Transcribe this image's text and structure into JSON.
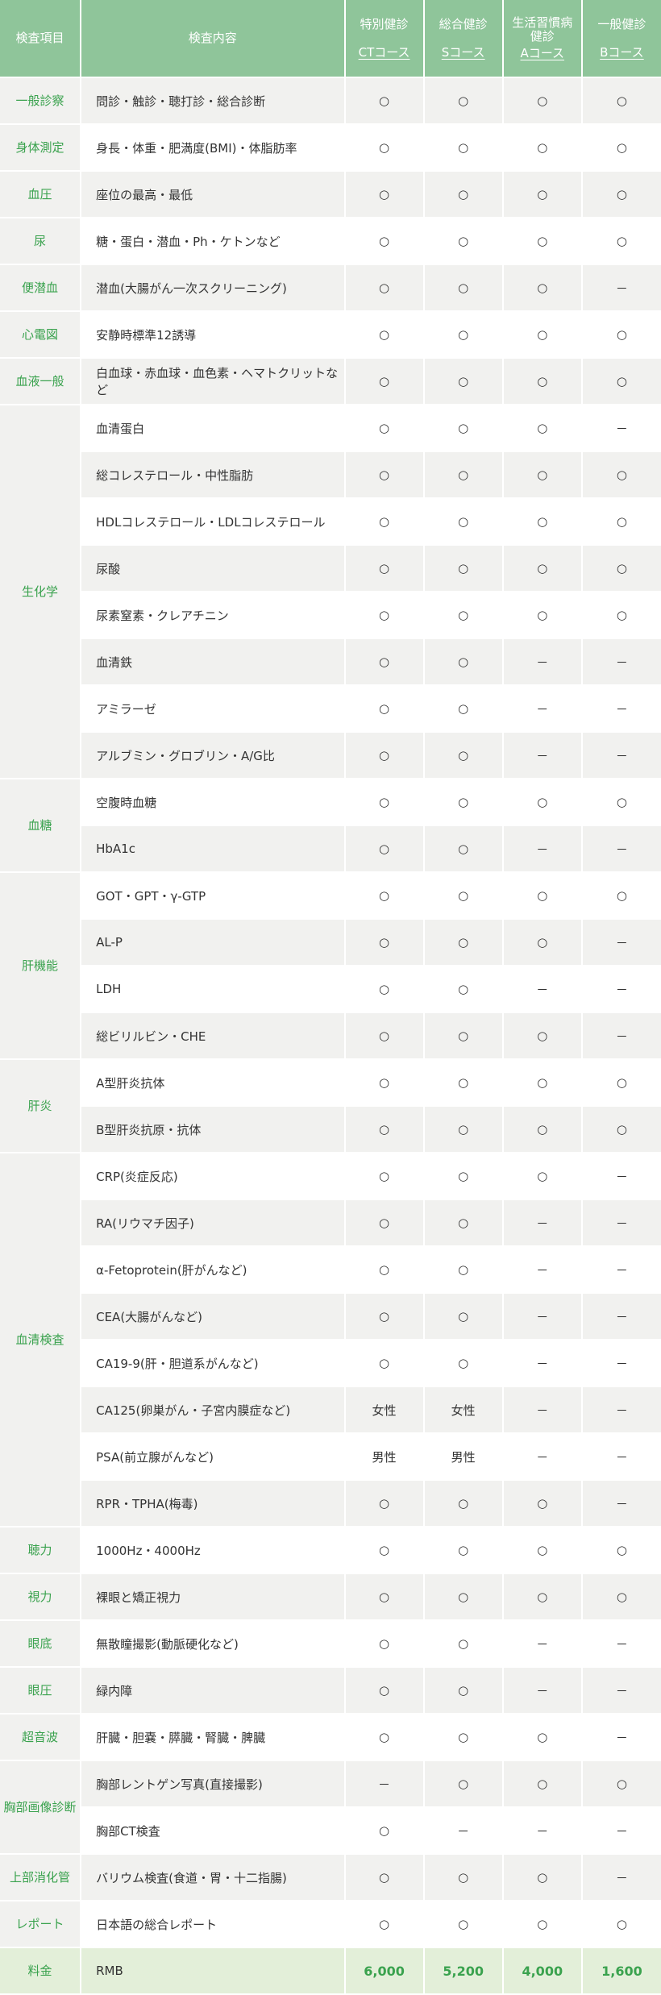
{
  "header": {
    "category": "検査項目",
    "content": "検査内容",
    "courses": [
      {
        "name": "特別健診",
        "code": "CTコース"
      },
      {
        "name": "総合健診",
        "code": "Sコース"
      },
      {
        "name": "生活習慣病健診",
        "code": "Aコース"
      },
      {
        "name": "一般健診",
        "code": "Bコース"
      }
    ]
  },
  "groups": [
    {
      "category": "一般診察",
      "rows": [
        {
          "item": "問診・触診・聴打診・総合診断",
          "marks": [
            "○",
            "○",
            "○",
            "○"
          ]
        }
      ]
    },
    {
      "category": "身体測定",
      "rows": [
        {
          "item": "身長・体重・肥満度(BMI)・体脂肪率",
          "marks": [
            "○",
            "○",
            "○",
            "○"
          ]
        }
      ]
    },
    {
      "category": "血圧",
      "rows": [
        {
          "item": "座位の最高・最低",
          "marks": [
            "○",
            "○",
            "○",
            "○"
          ]
        }
      ]
    },
    {
      "category": "尿",
      "rows": [
        {
          "item": "糖・蛋白・潜血・Ph・ケトンなど",
          "marks": [
            "○",
            "○",
            "○",
            "○"
          ]
        }
      ]
    },
    {
      "category": "便潜血",
      "rows": [
        {
          "item": "潜血(大腸がん一次スクリーニング)",
          "marks": [
            "○",
            "○",
            "○",
            "－"
          ]
        }
      ]
    },
    {
      "category": "心電図",
      "rows": [
        {
          "item": "安静時標準12誘導",
          "marks": [
            "○",
            "○",
            "○",
            "○"
          ]
        }
      ]
    },
    {
      "category": "血液一般",
      "rows": [
        {
          "item": "白血球・赤血球・血色素・ヘマトクリットなど",
          "marks": [
            "○",
            "○",
            "○",
            "○"
          ]
        }
      ]
    },
    {
      "category": "生化学",
      "rows": [
        {
          "item": "血清蛋白",
          "marks": [
            "○",
            "○",
            "○",
            "－"
          ]
        },
        {
          "item": "総コレステロール・中性脂肪",
          "marks": [
            "○",
            "○",
            "○",
            "○"
          ]
        },
        {
          "item": "HDLコレステロール・LDLコレステロール",
          "marks": [
            "○",
            "○",
            "○",
            "○"
          ]
        },
        {
          "item": "尿酸",
          "marks": [
            "○",
            "○",
            "○",
            "○"
          ]
        },
        {
          "item": "尿素窒素・クレアチニン",
          "marks": [
            "○",
            "○",
            "○",
            "○"
          ]
        },
        {
          "item": "血清鉄",
          "marks": [
            "○",
            "○",
            "－",
            "－"
          ]
        },
        {
          "item": "アミラーゼ",
          "marks": [
            "○",
            "○",
            "－",
            "－"
          ]
        },
        {
          "item": "アルブミン・グロブリン・A/G比",
          "marks": [
            "○",
            "○",
            "－",
            "－"
          ]
        }
      ]
    },
    {
      "category": "血糖",
      "rows": [
        {
          "item": "空腹時血糖",
          "marks": [
            "○",
            "○",
            "○",
            "○"
          ]
        },
        {
          "item": "HbA1c",
          "marks": [
            "○",
            "○",
            "－",
            "－"
          ]
        }
      ]
    },
    {
      "category": "肝機能",
      "rows": [
        {
          "item": "GOT・GPT・γ-GTP",
          "marks": [
            "○",
            "○",
            "○",
            "○"
          ]
        },
        {
          "item": "AL-P",
          "marks": [
            "○",
            "○",
            "○",
            "－"
          ]
        },
        {
          "item": "LDH",
          "marks": [
            "○",
            "○",
            "－",
            "－"
          ]
        },
        {
          "item": "総ビリルビン・CHE",
          "marks": [
            "○",
            "○",
            "○",
            "－"
          ]
        }
      ]
    },
    {
      "category": "肝炎",
      "rows": [
        {
          "item": "A型肝炎抗体",
          "marks": [
            "○",
            "○",
            "○",
            "○"
          ]
        },
        {
          "item": "B型肝炎抗原・抗体",
          "marks": [
            "○",
            "○",
            "○",
            "○"
          ]
        }
      ]
    },
    {
      "category": "血清検査",
      "rows": [
        {
          "item": "CRP(炎症反応)",
          "marks": [
            "○",
            "○",
            "○",
            "－"
          ]
        },
        {
          "item": "RA(リウマチ因子)",
          "marks": [
            "○",
            "○",
            "－",
            "－"
          ]
        },
        {
          "item": "α-Fetoprotein(肝がんなど)",
          "marks": [
            "○",
            "○",
            "－",
            "－"
          ]
        },
        {
          "item": "CEA(大腸がんなど)",
          "marks": [
            "○",
            "○",
            "－",
            "－"
          ]
        },
        {
          "item": "CA19-9(肝・胆道系がんなど)",
          "marks": [
            "○",
            "○",
            "－",
            "－"
          ]
        },
        {
          "item": "CA125(卵巣がん・子宮内膜症など)",
          "marks": [
            "女性",
            "女性",
            "－",
            "－"
          ]
        },
        {
          "item": "PSA(前立腺がんなど)",
          "marks": [
            "男性",
            "男性",
            "－",
            "－"
          ]
        },
        {
          "item": "RPR・TPHA(梅毒)",
          "marks": [
            "○",
            "○",
            "○",
            "－"
          ]
        }
      ]
    },
    {
      "category": "聴力",
      "rows": [
        {
          "item": "1000Hz・4000Hz",
          "marks": [
            "○",
            "○",
            "○",
            "○"
          ]
        }
      ]
    },
    {
      "category": "視力",
      "rows": [
        {
          "item": "裸眼と矯正視力",
          "marks": [
            "○",
            "○",
            "○",
            "○"
          ]
        }
      ]
    },
    {
      "category": "眼底",
      "rows": [
        {
          "item": "無散瞳撮影(動脈硬化など)",
          "marks": [
            "○",
            "○",
            "－",
            "－"
          ]
        }
      ]
    },
    {
      "category": "眼圧",
      "rows": [
        {
          "item": "緑内障",
          "marks": [
            "○",
            "○",
            "－",
            "－"
          ]
        }
      ]
    },
    {
      "category": "超音波",
      "rows": [
        {
          "item": "肝臓・胆嚢・膵臓・腎臓・脾臓",
          "marks": [
            "○",
            "○",
            "○",
            "－"
          ]
        }
      ]
    },
    {
      "category": "胸部画像診断",
      "rows": [
        {
          "item": "胸部レントゲン写真(直接撮影)",
          "marks": [
            "－",
            "○",
            "○",
            "○"
          ]
        },
        {
          "item": "胸部CT検査",
          "marks": [
            "○",
            "－",
            "－",
            "－"
          ]
        }
      ]
    },
    {
      "category": "上部消化管",
      "rows": [
        {
          "item": "バリウム検査(食道・胃・十二指腸)",
          "marks": [
            "○",
            "○",
            "○",
            "－"
          ]
        }
      ]
    },
    {
      "category": "レポート",
      "rows": [
        {
          "item": "日本語の総合レポート",
          "marks": [
            "○",
            "○",
            "○",
            "○"
          ]
        }
      ]
    }
  ],
  "price": {
    "category": "料金",
    "item": "RMB",
    "values": [
      "6,000",
      "5,200",
      "4,000",
      "1,600"
    ]
  }
}
